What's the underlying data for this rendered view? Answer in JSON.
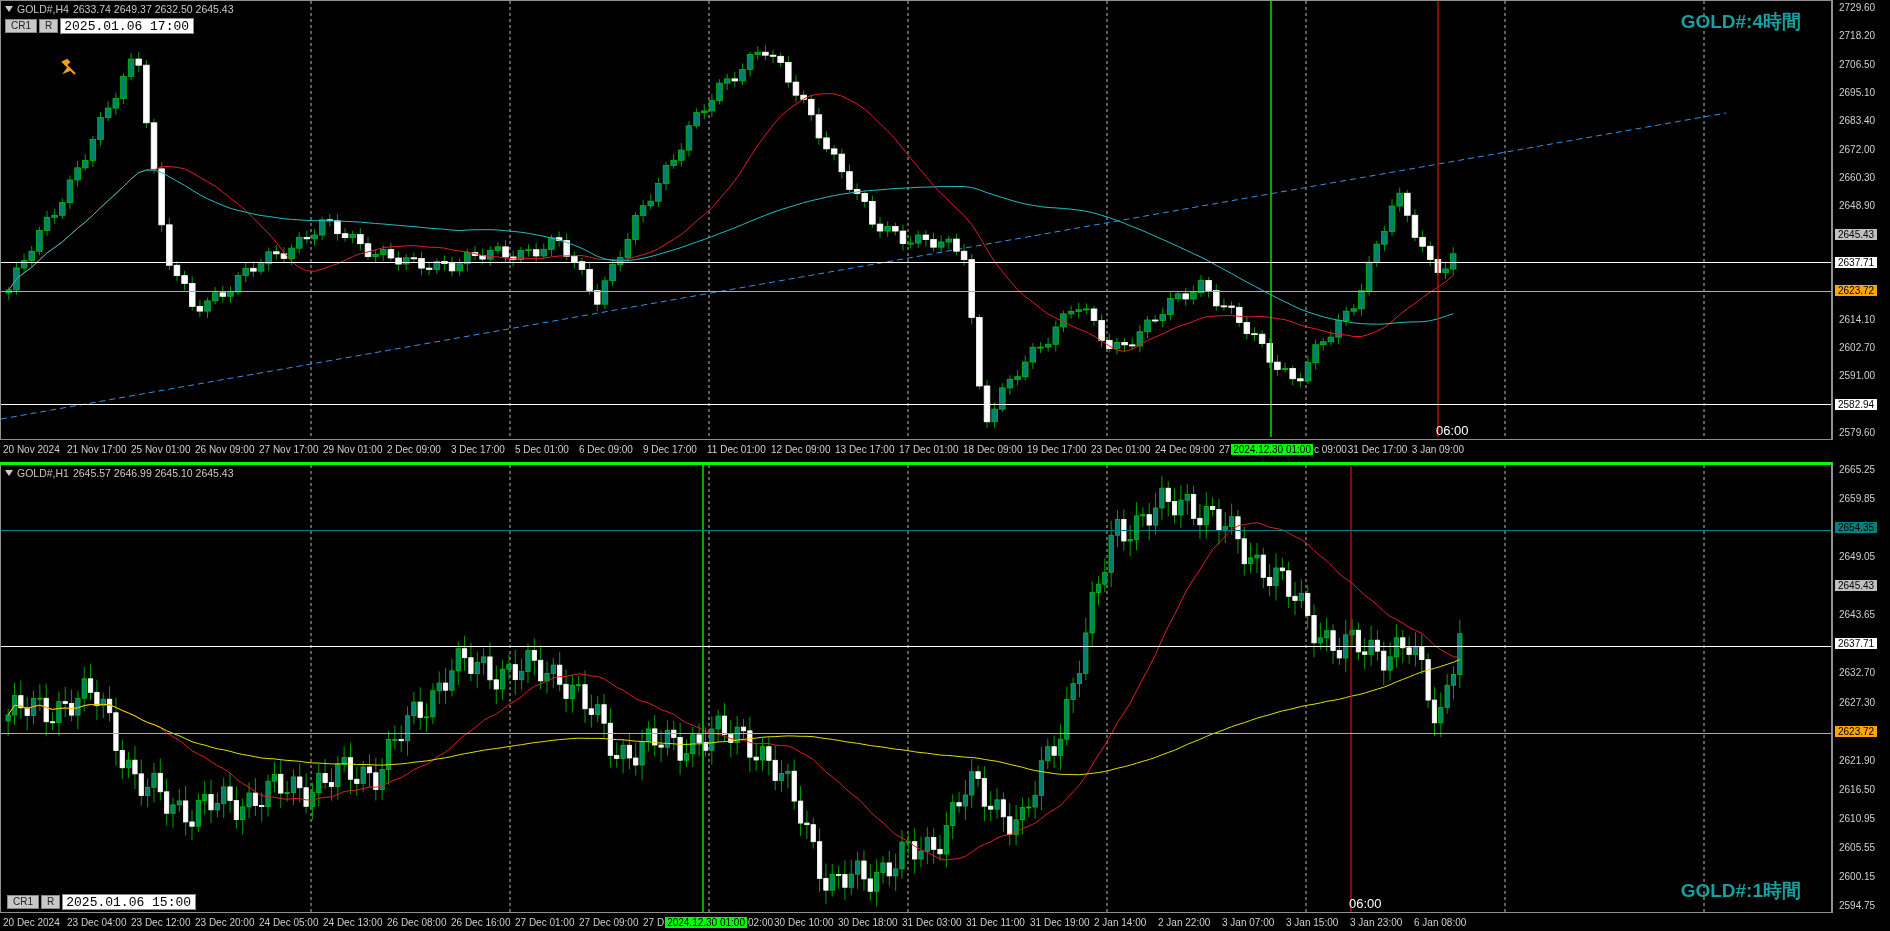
{
  "panes": [
    {
      "selected": false,
      "tool_icon": true,
      "header": {
        "symbol": "GOLD#,H4",
        "quote": "2633.74 2649.37 2632.50 2645.43"
      },
      "toolbar": {
        "buttons": [
          "CR1",
          "R"
        ],
        "time_field": "2025.01.06 17:00"
      },
      "title": "GOLD#:4時間",
      "cursor_time": "06:00",
      "price_axis": [
        {
          "kind": "tick",
          "text": "2729.60"
        },
        {
          "kind": "tick",
          "text": "2718.20"
        },
        {
          "kind": "tick",
          "text": "2706.50"
        },
        {
          "kind": "tick",
          "text": "2695.10"
        },
        {
          "kind": "tick",
          "text": "2683.40"
        },
        {
          "kind": "tick",
          "text": "2672.00"
        },
        {
          "kind": "tick",
          "text": "2660.30"
        },
        {
          "kind": "tick",
          "text": "2648.90"
        },
        {
          "kind": "tag",
          "text": "2645.43",
          "color": "#c0c0c0",
          "line": false
        },
        {
          "kind": "tag",
          "text": "2637.71",
          "color": "#ffffff",
          "line": true
        },
        {
          "kind": "tag",
          "text": "2623.72",
          "color": "#ffa500",
          "line": true
        },
        {
          "kind": "tick",
          "text": "2614.10"
        },
        {
          "kind": "tick",
          "text": "2602.70"
        },
        {
          "kind": "tick",
          "text": "2591.00"
        },
        {
          "kind": "tag",
          "text": "2582.94",
          "color": "#ffffff",
          "line": true
        },
        {
          "kind": "tick",
          "text": "2579.60"
        }
      ],
      "time_axis": [
        {
          "kind": "label",
          "text": "20 Nov 2024"
        },
        {
          "kind": "label",
          "text": "21 Nov 17:00"
        },
        {
          "kind": "label",
          "text": "25 Nov 01:00"
        },
        {
          "kind": "label",
          "text": "26 Nov 09:00"
        },
        {
          "kind": "label",
          "text": "27 Nov 17:00"
        },
        {
          "kind": "label",
          "text": "29 Nov 01:00"
        },
        {
          "kind": "label",
          "text": "2 Dec 09:00"
        },
        {
          "kind": "label",
          "text": "3 Dec 17:00"
        },
        {
          "kind": "label",
          "text": "5 Dec 01:00"
        },
        {
          "kind": "label",
          "text": "6 Dec 09:00"
        },
        {
          "kind": "label",
          "text": "9 Dec 17:00"
        },
        {
          "kind": "label",
          "text": "11 Dec 01:00"
        },
        {
          "kind": "label",
          "text": "12 Dec 09:00"
        },
        {
          "kind": "label",
          "text": "13 Dec 17:00"
        },
        {
          "kind": "label",
          "text": "17 Dec 01:00"
        },
        {
          "kind": "label",
          "text": "18 Dec 09:00"
        },
        {
          "kind": "label",
          "text": "19 Dec 17:00"
        },
        {
          "kind": "label",
          "text": "23 Dec 01:00"
        },
        {
          "kind": "label",
          "text": "24 Dec 09:00"
        },
        {
          "kind": "partial",
          "text": "27"
        },
        {
          "kind": "tag",
          "text": "2024.12.30 01:00"
        },
        {
          "kind": "partial",
          "text": "c 09:00"
        },
        {
          "kind": "label",
          "text": "31 Dec 17:00"
        },
        {
          "kind": "label",
          "text": "3 Jan 09:00"
        }
      ]
    },
    {
      "selected": true,
      "tool_icon": false,
      "header": {
        "symbol": "GOLD#,H1",
        "quote": "2645.57 2646.99 2645.10 2645.43"
      },
      "toolbar": {
        "buttons": [
          "CR1",
          "R"
        ],
        "time_field": "2025.01.06 15:00"
      },
      "title": "GOLD#:1時間",
      "cursor_time": "06:00",
      "price_axis": [
        {
          "kind": "tick",
          "text": "2665.25"
        },
        {
          "kind": "tick",
          "text": "2659.85"
        },
        {
          "kind": "tag",
          "text": "2654.35",
          "color": "#008080",
          "line": true
        },
        {
          "kind": "tick",
          "text": "2649.05"
        },
        {
          "kind": "tag",
          "text": "2645.43",
          "color": "#c0c0c0",
          "line": false
        },
        {
          "kind": "tick",
          "text": "2643.65"
        },
        {
          "kind": "tag",
          "text": "2637.71",
          "color": "#ffffff",
          "line": true
        },
        {
          "kind": "tick",
          "text": "2632.70"
        },
        {
          "kind": "tick",
          "text": "2627.30"
        },
        {
          "kind": "tag",
          "text": "2623.72",
          "color": "#ffa500",
          "line": true
        },
        {
          "kind": "tick",
          "text": "2621.90"
        },
        {
          "kind": "tick",
          "text": "2616.50"
        },
        {
          "kind": "tick",
          "text": "2610.95"
        },
        {
          "kind": "tick",
          "text": "2605.55"
        },
        {
          "kind": "tick",
          "text": "2600.15"
        },
        {
          "kind": "tick",
          "text": "2594.75"
        }
      ],
      "time_axis": [
        {
          "kind": "label",
          "text": "20 Dec 2024"
        },
        {
          "kind": "label",
          "text": "23 Dec 04:00"
        },
        {
          "kind": "label",
          "text": "23 Dec 12:00"
        },
        {
          "kind": "label",
          "text": "23 Dec 20:00"
        },
        {
          "kind": "label",
          "text": "24 Dec 05:00"
        },
        {
          "kind": "label",
          "text": "24 Dec 13:00"
        },
        {
          "kind": "label",
          "text": "26 Dec 08:00"
        },
        {
          "kind": "label",
          "text": "26 Dec 16:00"
        },
        {
          "kind": "label",
          "text": "27 Dec 01:00"
        },
        {
          "kind": "label",
          "text": "27 Dec 09:00"
        },
        {
          "kind": "partial",
          "text": "27 D"
        },
        {
          "kind": "tag",
          "text": "2024.12.30 01:00"
        },
        {
          "kind": "partial",
          "text": "02:00"
        },
        {
          "kind": "label",
          "text": "30 Dec 10:00"
        },
        {
          "kind": "label",
          "text": "30 Dec 18:00"
        },
        {
          "kind": "label",
          "text": "31 Dec 03:00"
        },
        {
          "kind": "label",
          "text": "31 Dec 11:00"
        },
        {
          "kind": "label",
          "text": "31 Dec 19:00"
        },
        {
          "kind": "label",
          "text": "2 Jan 14:00"
        },
        {
          "kind": "label",
          "text": "2 Jan 22:00"
        },
        {
          "kind": "label",
          "text": "3 Jan 07:00"
        },
        {
          "kind": "label",
          "text": "3 Jan 15:00"
        },
        {
          "kind": "label",
          "text": "3 Jan 23:00"
        },
        {
          "kind": "label",
          "text": "6 Jan 08:00"
        }
      ]
    }
  ]
}
